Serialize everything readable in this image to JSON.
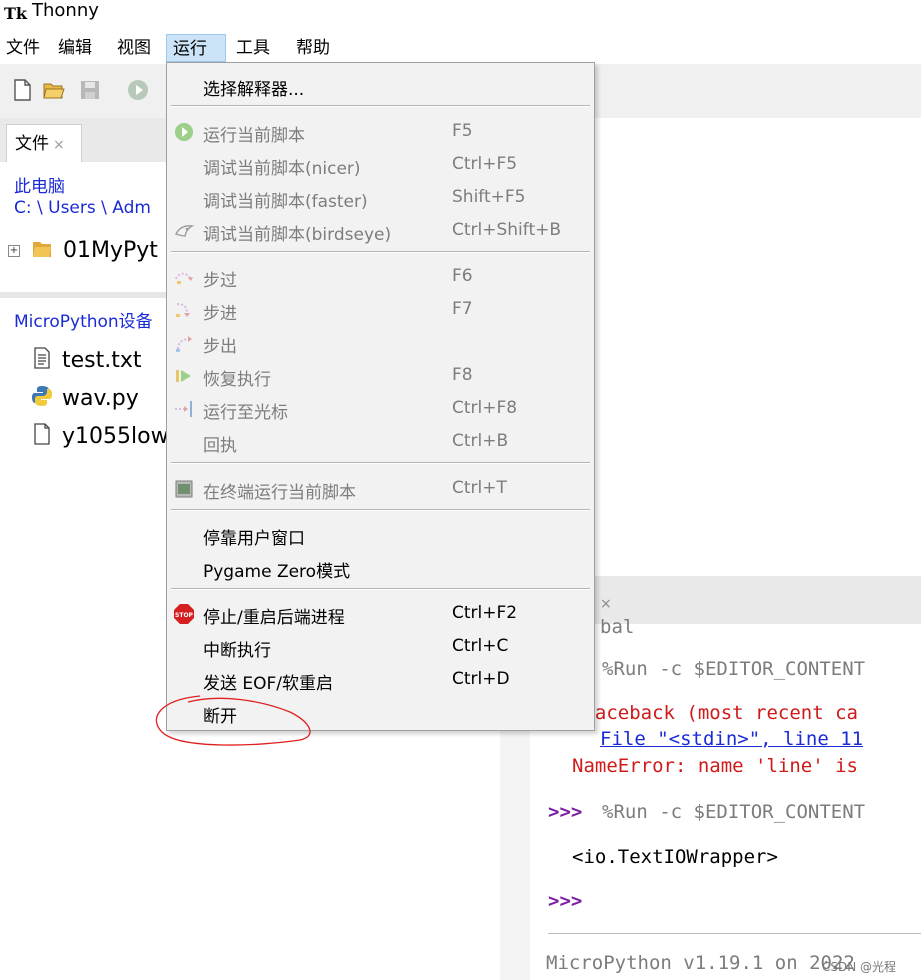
{
  "window": {
    "title": "Thonny",
    "app_icon_text": "Tk"
  },
  "menubar": [
    "文件",
    "编辑",
    "视图",
    "运行",
    "工具",
    "帮助"
  ],
  "left_panel": {
    "files_tab": "文件",
    "pc_label": "此电脑",
    "path": "C: \\ Users \\ Adm",
    "folder": "01MyPyt",
    "device_title": "MicroPython设备",
    "device_files": [
      "test.txt",
      "wav.py",
      "y1055low"
    ]
  },
  "run_menu": {
    "items": [
      {
        "label": "选择解释器...",
        "shortcut": "",
        "enabled": true,
        "icon": ""
      },
      {
        "label": "运行当前脚本",
        "shortcut": "F5",
        "enabled": false,
        "icon": "run-icon"
      },
      {
        "label": "调试当前脚本(nicer)",
        "shortcut": "Ctrl+F5",
        "enabled": false,
        "icon": ""
      },
      {
        "label": "调试当前脚本(faster)",
        "shortcut": "Shift+F5",
        "enabled": false,
        "icon": ""
      },
      {
        "label": "调试当前脚本(birdseye)",
        "shortcut": "Ctrl+Shift+B",
        "enabled": false,
        "icon": "birdseye-icon"
      },
      {
        "label": "步过",
        "shortcut": "F6",
        "enabled": false,
        "icon": "step-over-icon"
      },
      {
        "label": "步进",
        "shortcut": "F7",
        "enabled": false,
        "icon": "step-into-icon"
      },
      {
        "label": "步出",
        "shortcut": "",
        "enabled": false,
        "icon": "step-out-icon"
      },
      {
        "label": "恢复执行",
        "shortcut": "F8",
        "enabled": false,
        "icon": "resume-icon"
      },
      {
        "label": "运行至光标",
        "shortcut": "Ctrl+F8",
        "enabled": false,
        "icon": "run-to-cursor-icon"
      },
      {
        "label": "回执",
        "shortcut": "Ctrl+B",
        "enabled": false,
        "icon": ""
      },
      {
        "label": "在终端运行当前脚本",
        "shortcut": "Ctrl+T",
        "enabled": false,
        "icon": "terminal-icon"
      },
      {
        "label": "停靠用户窗口",
        "shortcut": "",
        "enabled": true,
        "icon": ""
      },
      {
        "label": "Pygame Zero模式",
        "shortcut": "",
        "enabled": true,
        "icon": ""
      },
      {
        "label": "停止/重启后端进程",
        "shortcut": "Ctrl+F2",
        "enabled": true,
        "icon": "stop-icon"
      },
      {
        "label": "中断执行",
        "shortcut": "Ctrl+C",
        "enabled": true,
        "icon": ""
      },
      {
        "label": "发送 EOF/软重启",
        "shortcut": "Ctrl+D",
        "enabled": true,
        "icon": ""
      },
      {
        "label": "断开",
        "shortcut": "",
        "enabled": true,
        "icon": ""
      }
    ]
  },
  "shell": {
    "line0": "bal",
    "line1": "%Run -c $EDITOR_CONTENT",
    "traceback": "Traceback (most recent ca",
    "file_ref": "File \"<stdin>\", line 11",
    "error": "NameError: name 'line' is",
    "prompt": ">>>",
    "line2": "%Run -c $EDITOR_CONTENT",
    "output": "<io.TextIOWrapper>",
    "footer": "MicroPython v1.19.1 on 2022"
  },
  "watermark": "CSDN @光程",
  "colors": {
    "menu_active": "#cce4f7",
    "link": "#1a2bd6",
    "error": "#d01a1a",
    "prompt": "#7b1fa2",
    "annotation": "#e02020"
  }
}
